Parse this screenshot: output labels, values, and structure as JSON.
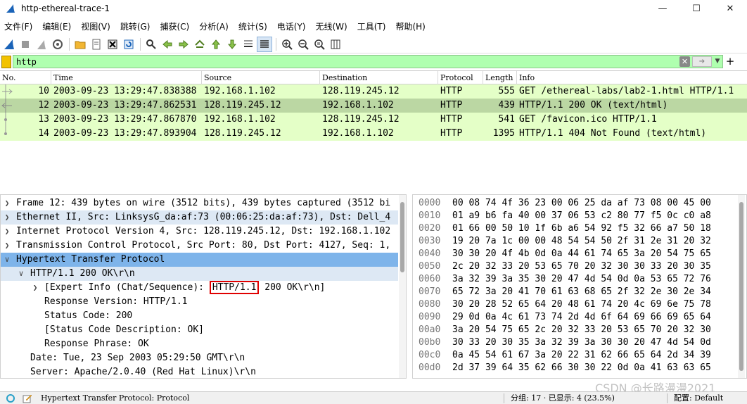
{
  "window": {
    "title": "http-ethereal-trace-1"
  },
  "menu": [
    "文件(F)",
    "编辑(E)",
    "视图(V)",
    "跳转(G)",
    "捕获(C)",
    "分析(A)",
    "统计(S)",
    "电话(Y)",
    "无线(W)",
    "工具(T)",
    "帮助(H)"
  ],
  "filter": {
    "value": "http"
  },
  "columns": [
    "No.",
    "Time",
    "Source",
    "Destination",
    "Protocol",
    "Length",
    "Info"
  ],
  "packets": [
    {
      "no": "10",
      "time": "2003-09-23 13:29:47.838388",
      "src": "192.168.1.102",
      "dst": "128.119.245.12",
      "proto": "HTTP",
      "len": "555",
      "info": "GET /ethereal-labs/lab2-1.html HTTP/1.1"
    },
    {
      "no": "12",
      "time": "2003-09-23 13:29:47.862531",
      "src": "128.119.245.12",
      "dst": "192.168.1.102",
      "proto": "HTTP",
      "len": "439",
      "info": "HTTP/1.1 200 OK  (text/html)"
    },
    {
      "no": "13",
      "time": "2003-09-23 13:29:47.867870",
      "src": "192.168.1.102",
      "dst": "128.119.245.12",
      "proto": "HTTP",
      "len": "541",
      "info": "GET /favicon.ico HTTP/1.1"
    },
    {
      "no": "14",
      "time": "2003-09-23 13:29:47.893904",
      "src": "128.119.245.12",
      "dst": "192.168.1.102",
      "proto": "HTTP",
      "len": "1395",
      "info": "HTTP/1.1 404 Not Found  (text/html)"
    }
  ],
  "details": [
    {
      "text": "Frame 12: 439 bytes on wire (3512 bits), 439 bytes captured (3512 bi"
    },
    {
      "text": "Ethernet II, Src: LinksysG_da:af:73 (00:06:25:da:af:73), Dst: Dell_4"
    },
    {
      "text": "Internet Protocol Version 4, Src: 128.119.245.12, Dst: 192.168.1.102"
    },
    {
      "text": "Transmission Control Protocol, Src Port: 80, Dst Port: 4127, Seq: 1,"
    },
    {
      "text": "Hypertext Transfer Protocol"
    },
    {
      "text": "HTTP/1.1 200 OK\\r\\n"
    },
    {
      "pre": "[Expert Info (Chat/Sequence): ",
      "boxed": "HTTP/1.1",
      "post": " 200 OK\\r\\n]"
    },
    {
      "text": "Response Version: HTTP/1.1"
    },
    {
      "text": "Status Code: 200"
    },
    {
      "text": "[Status Code Description: OK]"
    },
    {
      "text": "Response Phrase: OK"
    },
    {
      "text": "Date: Tue, 23 Sep 2003 05:29:50 GMT\\r\\n"
    },
    {
      "text": "Server: Apache/2.0.40 (Red Hat Linux)\\r\\n"
    }
  ],
  "bytes": [
    {
      "off": "0000",
      "hex": "00 08 74 4f 36 23 00 06  25 da af 73 08 00 45 00"
    },
    {
      "off": "0010",
      "hex": "01 a9 b6 fa 40 00 37 06  53 c2 80 77 f5 0c c0 a8"
    },
    {
      "off": "0020",
      "hex": "01 66 00 50 10 1f 6b a6  54 92 f5 32 66 a7 50 18"
    },
    {
      "off": "0030",
      "hex": "19 20 7a 1c 00 00 48 54  54 50 2f 31 2e 31 20 32"
    },
    {
      "off": "0040",
      "hex": "30 30 20 4f 4b 0d 0a 44  61 74 65 3a 20 54 75 65"
    },
    {
      "off": "0050",
      "hex": "2c 20 32 33 20 53 65 70  20 32 30 30 33 20 30 35"
    },
    {
      "off": "0060",
      "hex": "3a 32 39 3a 35 30 20 47  4d 54 0d 0a 53 65 72 76"
    },
    {
      "off": "0070",
      "hex": "65 72 3a 20 41 70 61 63  68 65 2f 32 2e 30 2e 34"
    },
    {
      "off": "0080",
      "hex": "30 20 28 52 65 64 20 48  61 74 20 4c 69 6e 75 78"
    },
    {
      "off": "0090",
      "hex": "29 0d 0a 4c 61 73 74 2d  4d 6f 64 69 66 69 65 64"
    },
    {
      "off": "00a0",
      "hex": "3a 20 54 75 65 2c 20 32  33 20 53 65 70 20 32 30"
    },
    {
      "off": "00b0",
      "hex": "30 33 20 30 35 3a 32 39  3a 30 30 20 47 4d 54 0d"
    },
    {
      "off": "00c0",
      "hex": "0a 45 54 61 67 3a 20 22  31 62 66 65 64 2d 34 39"
    },
    {
      "off": "00d0",
      "hex": "2d 37 39 64 35 62 66 30  30 22 0d 0a 41 63 63 65"
    }
  ],
  "status": {
    "text": "Hypertext Transfer Protocol: Protocol",
    "count": "分组: 17 · 已显示: 4 (23.5%)",
    "profile": "配置: Default"
  },
  "watermark": "CSDN @长路漫漫2021"
}
